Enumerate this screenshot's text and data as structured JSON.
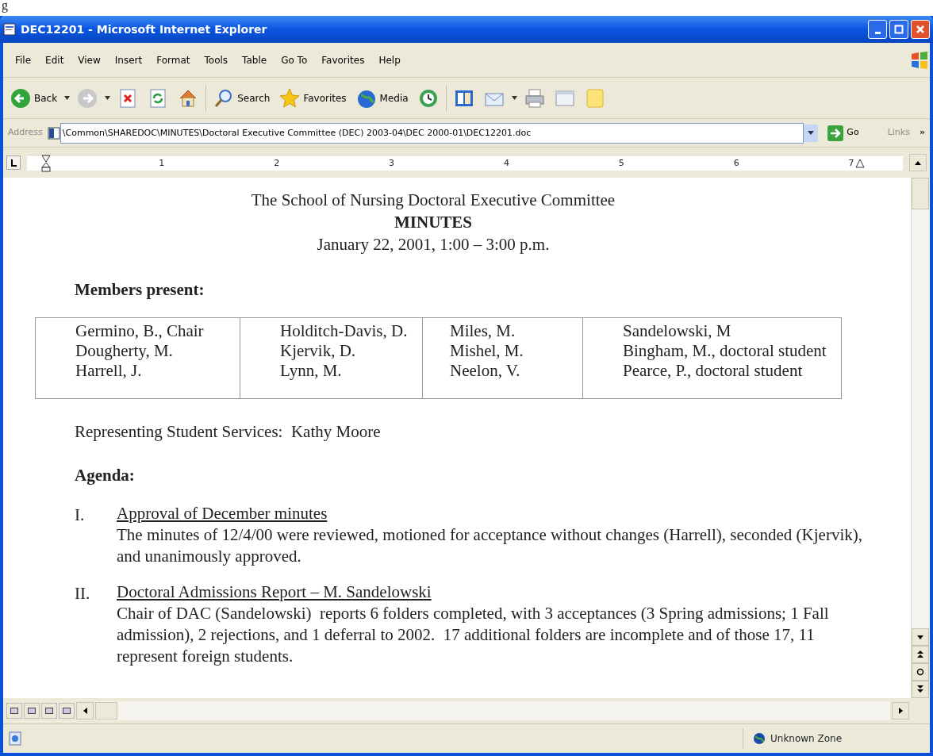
{
  "caption_fragment": "g",
  "window": {
    "title": "DEC12201 - Microsoft Internet Explorer"
  },
  "menu": [
    "File",
    "Edit",
    "View",
    "Insert",
    "Format",
    "Tools",
    "Table",
    "Go To",
    "Favorites",
    "Help"
  ],
  "toolbar": [
    {
      "kind": "back",
      "label": "Back",
      "dropdown": true
    },
    {
      "kind": "forward",
      "dropdown": true
    },
    {
      "kind": "stop"
    },
    {
      "kind": "refresh"
    },
    {
      "kind": "home"
    },
    {
      "kind": "search",
      "label": "Search"
    },
    {
      "kind": "favorites",
      "label": "Favorites"
    },
    {
      "kind": "media",
      "label": "Media"
    },
    {
      "kind": "history"
    },
    {
      "kind": "research"
    },
    {
      "kind": "mail",
      "dropdown": true
    },
    {
      "kind": "print"
    },
    {
      "kind": "edit"
    },
    {
      "kind": "note"
    }
  ],
  "address": {
    "label": "Address",
    "value": "\\Common\\SHAREDOC\\MINUTES\\Doctoral Executive Committee (DEC) 2003-04\\DEC 2000-01\\DEC12201.doc",
    "go": "Go",
    "links": "Links",
    "chevron": "»"
  },
  "ruler": {
    "numbers": [
      "1",
      "2",
      "3",
      "4",
      "5",
      "6",
      "7"
    ]
  },
  "document": {
    "heading": [
      "The School of Nursing Doctoral Executive Committee",
      "MINUTES",
      "January 22, 2001, 1:00 – 3:00 p.m."
    ],
    "members_label": "Members present:",
    "members": [
      [
        "Germino, B., Chair",
        "Dougherty, M.",
        "Harrell, J."
      ],
      [
        "Holditch-Davis, D.",
        "Kjervik, D.",
        "Lynn, M."
      ],
      [
        "Miles, M.",
        "Mishel, M.",
        "Neelon, V."
      ],
      [
        "Sandelowski, M",
        "Bingham, M., doctoral student",
        "Pearce, P., doctoral student"
      ]
    ],
    "representing": "Representing Student Services:  Kathy Moore",
    "agenda_label": "Agenda:",
    "items": [
      {
        "numeral": "I.",
        "title": "Approval of December minutes",
        "text": "The minutes of 12/4/00 were reviewed, motioned for acceptance without changes (Harrell), seconded (Kjervik), and unanimously approved."
      },
      {
        "numeral": "II.",
        "title": "Doctoral Admissions Report – M. Sandelowski",
        "text": "Chair of DAC (Sandelowski)  reports 6 folders completed, with 3 acceptances (3 Spring admissions; 1 Fall admission), 2 rejections, and 1 deferral to 2002.  17 additional folders are incomplete and of those 17, 11 represent foreign students."
      }
    ]
  },
  "status_bar": {
    "zone": "Unknown Zone"
  }
}
